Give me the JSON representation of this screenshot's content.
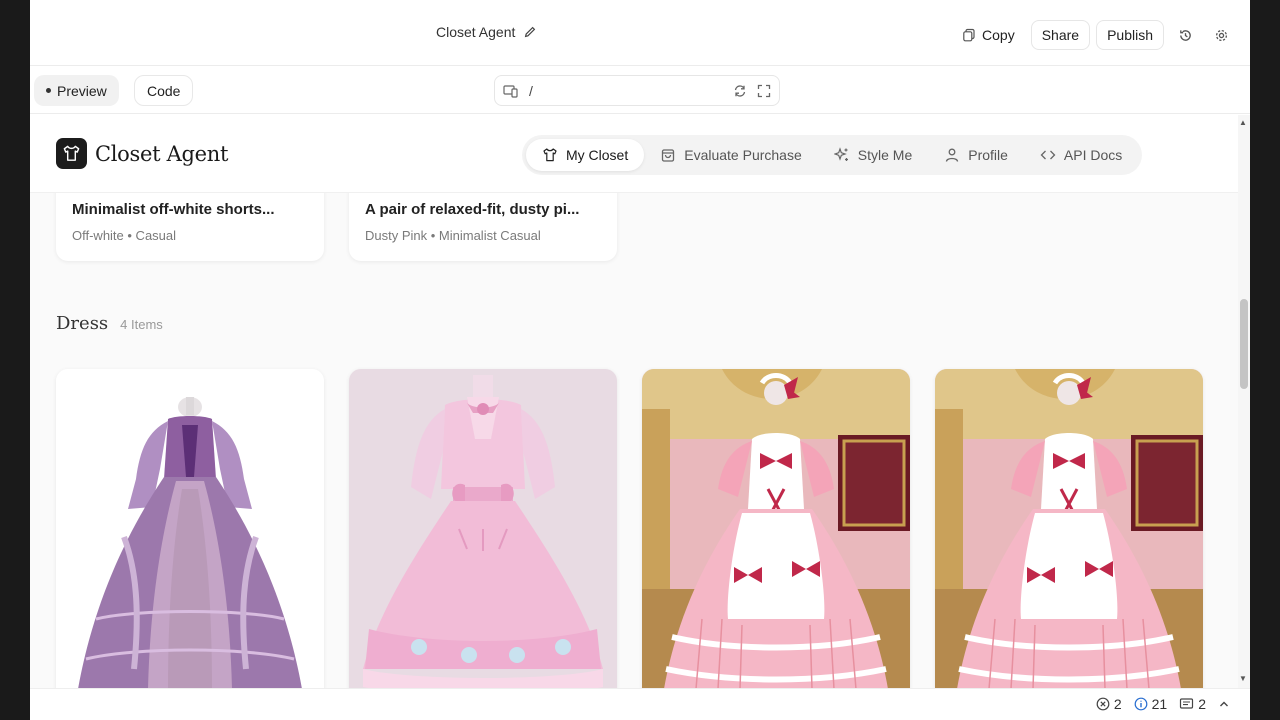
{
  "editor": {
    "project_title": "Closet Agent",
    "copy_label": "Copy",
    "share_label": "Share",
    "publish_label": "Publish"
  },
  "preview_bar": {
    "preview_label": "Preview",
    "code_label": "Code",
    "url_path": "/"
  },
  "app": {
    "brand": "Closet Agent",
    "nav": [
      {
        "label": "My Closet",
        "icon": "shirt-icon"
      },
      {
        "label": "Evaluate Purchase",
        "icon": "bag-icon"
      },
      {
        "label": "Style Me",
        "icon": "sparkle-icon"
      },
      {
        "label": "Profile",
        "icon": "user-icon"
      },
      {
        "label": "API Docs",
        "icon": "code-icon"
      }
    ],
    "top_cards": [
      {
        "title": "Minimalist off-white shorts...",
        "meta": "Off-white • Casual"
      },
      {
        "title": "A pair of relaxed-fit, dusty pi...",
        "meta": "Dusty Pink • Minimalist Casual"
      }
    ],
    "section": {
      "title": "Dress",
      "count": "4 Items"
    },
    "dresses": [
      {
        "image": "purple-rococo-gown"
      },
      {
        "image": "pink-lolita-dress"
      },
      {
        "image": "pink-maid-dress"
      },
      {
        "image": "pink-maid-dress"
      }
    ]
  },
  "status": {
    "errors": "2",
    "infos": "21",
    "messages": "2"
  },
  "colors": {
    "accent_dark": "#1c1c1c",
    "nav_bg": "#f3f3f3",
    "dress_purple": "#a07ab0",
    "dress_pink": "#f2b8d0",
    "bow_red": "#c0284a"
  }
}
